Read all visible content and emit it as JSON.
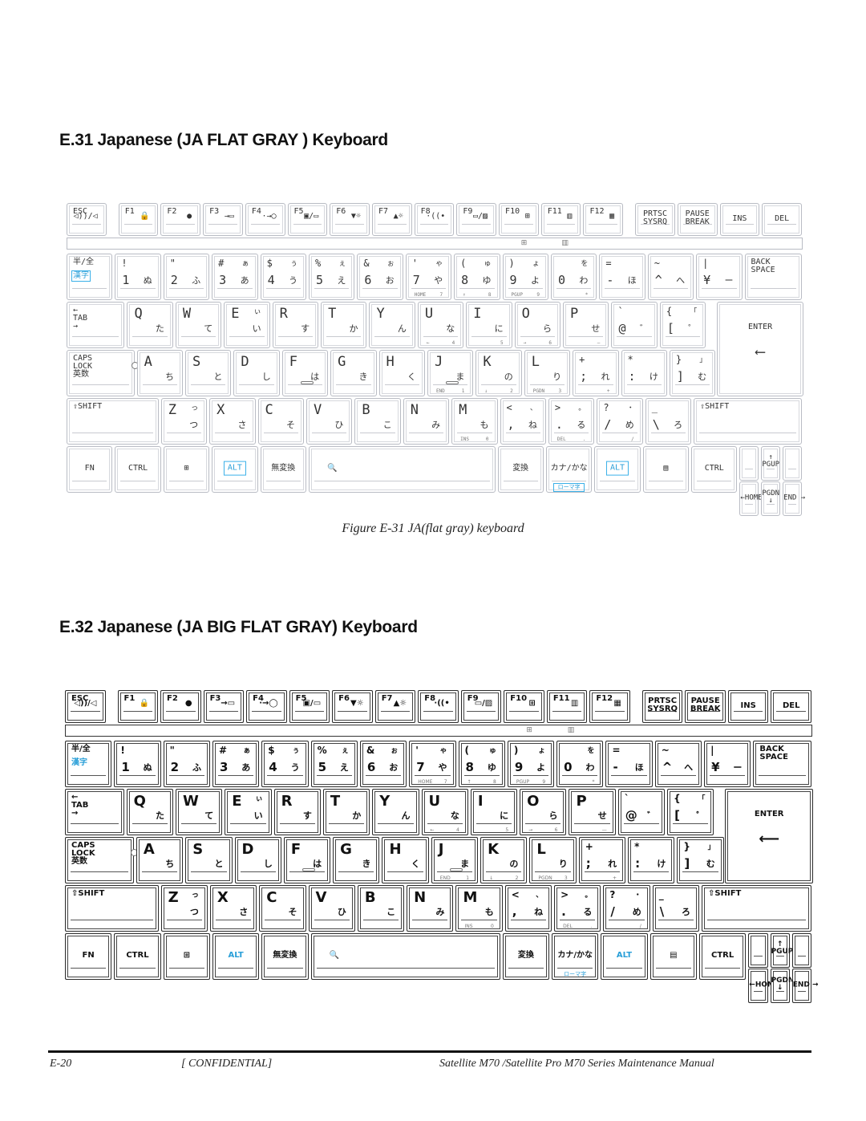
{
  "sections": [
    {
      "heading": "E.31 Japanese (JA FLAT GRAY )  Keyboard",
      "caption": "Figure E-31 JA(flat gray) keyboard"
    },
    {
      "heading": "E.32 Japanese (JA BIG FLAT GRAY)  Keyboard",
      "caption": ""
    }
  ],
  "keyboard": {
    "function_row": [
      {
        "main": "ESC",
        "icon": "◁))/◁"
      },
      {
        "main": "F1",
        "icon": "🔒"
      },
      {
        "main": "F2",
        "icon": "●"
      },
      {
        "main": "F3",
        "icon": "→▭"
      },
      {
        "main": "F4",
        "icon": "·→◯"
      },
      {
        "main": "F5",
        "icon": "▣/▭"
      },
      {
        "main": "F6",
        "icon": "▼☼"
      },
      {
        "main": "F7",
        "icon": "▲☼"
      },
      {
        "main": "F8",
        "icon": "·((•"
      },
      {
        "main": "F9",
        "icon": "▭/▨"
      },
      {
        "main": "F10",
        "icon": "⊞"
      },
      {
        "main": "F11",
        "icon": "▥"
      },
      {
        "main": "F12",
        "icon": "▦"
      },
      {
        "main": "PRTSC\nSYSRQ"
      },
      {
        "main": "PAUSE\nBREAK"
      },
      {
        "main": "INS"
      },
      {
        "main": "DEL"
      }
    ],
    "indicators": [
      "⊞",
      "▥"
    ],
    "number_row": [
      {
        "top": "半/全",
        "bottom": "漢字",
        "highlight": "bottom"
      },
      {
        "shift": "!",
        "main": "1",
        "kana": "ぬ"
      },
      {
        "shift": "\"",
        "main": "2",
        "kana": "ふ"
      },
      {
        "shift": "#",
        "main": "3",
        "kana": "あ",
        "kana_shift": "ぁ"
      },
      {
        "shift": "$",
        "main": "4",
        "kana": "う",
        "kana_shift": "ぅ"
      },
      {
        "shift": "%",
        "main": "5",
        "kana": "え",
        "kana_shift": "ぇ"
      },
      {
        "shift": "&",
        "main": "6",
        "kana": "お",
        "kana_shift": "ぉ"
      },
      {
        "shift": "'",
        "main": "7",
        "kana": "や",
        "kana_shift": "ゃ",
        "sub": [
          "HOME",
          "7"
        ]
      },
      {
        "shift": "(",
        "main": "8",
        "kana": "ゆ",
        "kana_shift": "ゅ",
        "sub": [
          "↑",
          "8"
        ]
      },
      {
        "shift": ")",
        "main": "9",
        "kana": "よ",
        "kana_shift": "ょ",
        "sub": [
          "PGUP",
          "9"
        ]
      },
      {
        "shift": "",
        "main": "0",
        "kana": "わ",
        "kana_shift": "を",
        "sub": [
          "",
          "*"
        ]
      },
      {
        "shift": "=",
        "main": "-",
        "kana": "ほ"
      },
      {
        "shift": "~",
        "main": "^",
        "kana": "へ"
      },
      {
        "shift": "|",
        "main": "¥",
        "kana": "ー"
      },
      {
        "main": "BACK\nSPACE"
      }
    ],
    "qwerty_row": [
      {
        "main": "←\nTAB\n→"
      },
      {
        "main": "Q",
        "kana": "た"
      },
      {
        "main": "W",
        "kana": "て"
      },
      {
        "main": "E",
        "kana": "い",
        "kana_shift": "ぃ"
      },
      {
        "main": "R",
        "kana": "す"
      },
      {
        "main": "T",
        "kana": "か"
      },
      {
        "main": "Y",
        "kana": "ん"
      },
      {
        "main": "U",
        "kana": "な",
        "sub": [
          "←",
          "4"
        ]
      },
      {
        "main": "I",
        "kana": "に",
        "sub": [
          "",
          "5"
        ]
      },
      {
        "main": "O",
        "kana": "ら",
        "sub": [
          "→",
          "6"
        ]
      },
      {
        "main": "P",
        "kana": "せ",
        "sub": [
          "",
          "—"
        ]
      },
      {
        "shift": "`",
        "main": "@",
        "kana": "゛"
      },
      {
        "shift": "{",
        "main": "[",
        "kana": "゜",
        "kana_shift": "「"
      }
    ],
    "enter": {
      "main": "ENTER",
      "icon": "⟵"
    },
    "home_row": [
      {
        "main": "CAPS\nLOCK\n英数"
      },
      {
        "main": "A",
        "kana": "ち"
      },
      {
        "main": "S",
        "kana": "と"
      },
      {
        "main": "D",
        "kana": "し"
      },
      {
        "main": "F",
        "kana": "は",
        "bump": true
      },
      {
        "main": "G",
        "kana": "き"
      },
      {
        "main": "H",
        "kana": "く"
      },
      {
        "main": "J",
        "kana": "ま",
        "bump": true,
        "sub": [
          "END",
          "1"
        ]
      },
      {
        "main": "K",
        "kana": "の",
        "sub": [
          "↓",
          "2"
        ]
      },
      {
        "main": "L",
        "kana": "り",
        "sub": [
          "PGDN",
          "3"
        ]
      },
      {
        "shift": "+",
        "main": ";",
        "kana": "れ",
        "sub": [
          "",
          "+"
        ]
      },
      {
        "shift": "*",
        "main": ":",
        "kana": "け"
      },
      {
        "shift": "}",
        "main": "]",
        "kana": "む",
        "kana_shift": "」"
      }
    ],
    "shift_row": [
      {
        "main": "⇧SHIFT"
      },
      {
        "main": "Z",
        "kana": "つ",
        "kana_shift": "っ"
      },
      {
        "main": "X",
        "kana": "さ"
      },
      {
        "main": "C",
        "kana": "そ"
      },
      {
        "main": "V",
        "kana": "ひ"
      },
      {
        "main": "B",
        "kana": "こ"
      },
      {
        "main": "N",
        "kana": "み"
      },
      {
        "main": "M",
        "kana": "も",
        "sub": [
          "INS",
          "0"
        ]
      },
      {
        "shift": "<",
        "main": ",",
        "kana": "ね",
        "kana_shift": "、"
      },
      {
        "shift": ">",
        "main": ".",
        "kana": "る",
        "kana_shift": "。",
        "sub": [
          "DEL",
          "."
        ]
      },
      {
        "shift": "?",
        "main": "/",
        "kana": "め",
        "kana_shift": "・",
        "sub": [
          "",
          "/"
        ]
      },
      {
        "shift": "_",
        "main": "\\",
        "kana": "ろ"
      },
      {
        "main": "⇧SHIFT"
      }
    ],
    "bottom_row": [
      {
        "main": "FN"
      },
      {
        "main": "CTRL"
      },
      {
        "main": "⊞",
        "icon": "windows-logo"
      },
      {
        "main": "ALT",
        "highlight": "main"
      },
      {
        "main": "無変換"
      },
      {
        "main": "🔍",
        "icon": "space-magnifier"
      },
      {
        "main": "変換"
      },
      {
        "main": "カナ/かな",
        "bottom": "ローマ字",
        "highlight": "bottom"
      },
      {
        "main": "ALT",
        "highlight": "main"
      },
      {
        "main": "▤",
        "icon": "application-menu"
      },
      {
        "main": "CTRL"
      }
    ],
    "nav_cluster": {
      "pgup": "↑\nPGUP",
      "pgdn": "PGDN\n↓",
      "home": "←HOME",
      "end": "END →"
    },
    "highlight_color": "#2a9fd8"
  },
  "footer": {
    "page": "E-20",
    "confidential": "[ CONFIDENTIAL]",
    "manual": "Satellite M70 /Satellite Pro M70 Series Maintenance Manual"
  }
}
